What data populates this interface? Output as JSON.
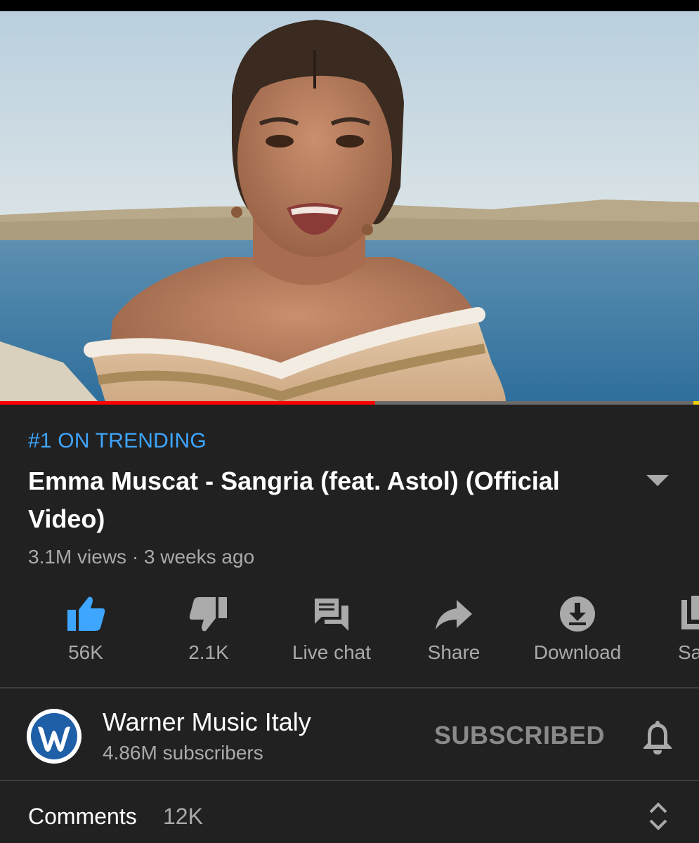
{
  "video": {
    "progress": 0.537,
    "trending_badge": "#1 ON TRENDING",
    "title": "Emma Muscat - Sangria (feat. Astol) (Official Video)",
    "meta": "3.1M views · 3 weeks ago"
  },
  "actions": {
    "like": {
      "label": "56K",
      "icon": "thumb-up-icon",
      "active": true
    },
    "dislike": {
      "label": "2.1K",
      "icon": "thumb-down-icon"
    },
    "live_chat": {
      "label": "Live chat",
      "icon": "chat-icon"
    },
    "share": {
      "label": "Share",
      "icon": "share-arrow-icon"
    },
    "download": {
      "label": "Download",
      "icon": "download-icon"
    },
    "save": {
      "label": "Sa",
      "icon": "playlist-add-icon"
    }
  },
  "channel": {
    "name": "Warner Music Italy",
    "subscribers": "4.86M subscribers",
    "subscribe_label": "SUBSCRIBED",
    "logo_letter": "W",
    "logo_color": "#1e5fa8"
  },
  "comments": {
    "label": "Comments",
    "count": "12K"
  },
  "colors": {
    "background": "#212121",
    "accent_blue": "#3ea6ff",
    "progress_red": "#ff0000",
    "secondary_text": "#aaaaaa"
  }
}
